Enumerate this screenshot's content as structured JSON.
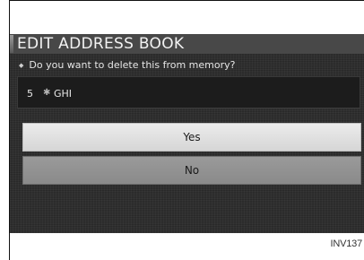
{
  "dialog": {
    "title": "EDIT ADDRESS BOOK",
    "prompt": "Do you want to delete this from memory?",
    "bullet_icon": "diamond-bullet-icon"
  },
  "entry": {
    "number": "5",
    "icon": "location-marker-icon",
    "name": "GHI"
  },
  "buttons": {
    "yes_label": "Yes",
    "no_label": "No",
    "selected": "Yes"
  },
  "figure_code": "INV137"
}
